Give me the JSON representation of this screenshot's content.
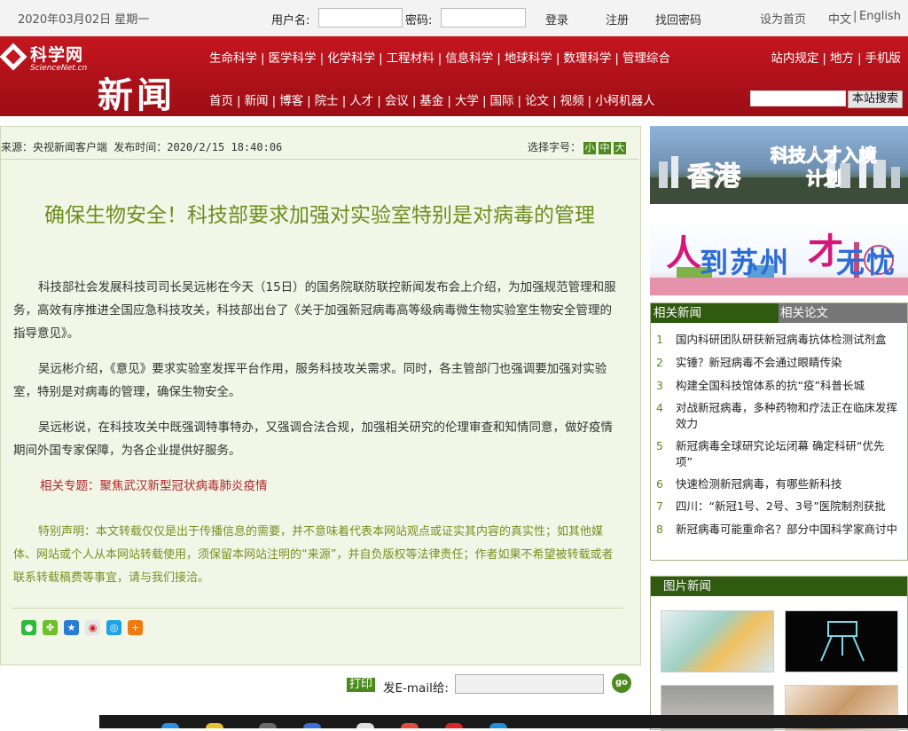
{
  "topbar": {
    "date": "2020年03月02日 星期一",
    "username_label": "用户名:",
    "password_label": "密码:",
    "login": "登录",
    "register": "注册",
    "recover_password": "找回密码",
    "set_homepage": "设为首页",
    "lang_cn": "中文",
    "lang_sep": "|",
    "lang_en": "English"
  },
  "header": {
    "logo_name": "科学网",
    "logo_en": "ScienceNet.cn",
    "section_title": "新闻",
    "nav_primary": [
      "生命科学",
      "医学科学",
      "化学科学",
      "工程材料",
      "信息科学",
      "地球科学",
      "数理科学",
      "管理综合"
    ],
    "nav_secondary": [
      "首页",
      "新闻",
      "博客",
      "院士",
      "人才",
      "会议",
      "基金",
      "大学",
      "国际",
      "论文",
      "视频",
      "小柯机器人"
    ],
    "nav_right": [
      "站内规定",
      "地方",
      "手机版"
    ],
    "search_button": "本站搜索",
    "separator": "|"
  },
  "article": {
    "meta": "来源：央视新闻客户端  发布时间：2020/2/15 18:40:06",
    "fontsize_label": "选择字号：",
    "fontsize_small": "小",
    "fontsize_medium": "中",
    "fontsize_large": "大",
    "title": "确保生物安全！科技部要求加强对实验室特别是对病毒的管理",
    "paragraphs": [
      "科技部社会发展科技司司长吴远彬在今天（15日）的国务院联防联控新闻发布会上介绍，为加强规范管理和服务，高效有序推进全国应急科技攻关，科技部出台了《关于加强新冠病毒高等级病毒微生物实验室生物安全管理的指导意见》。",
      "吴远彬介绍，《意见》要求实验室发挥平台作用，服务科技攻关需求。同时，各主管部门也强调要加强对实验室，特别是对病毒的管理，确保生物安全。",
      "吴远彬说，在科技攻关中既强调特事特办，又强调合法合规，加强相关研究的伦理审查和知情同意，做好疫情期间外国专家保障，为各企业提供好服务。"
    ],
    "topic": "相关专题：聚焦武汉新型冠状病毒肺炎疫情",
    "notice": "特别声明：本文转载仅仅是出于传播信息的需要，并不意味着代表本网站观点或证实其内容的真实性；如其他媒体、网站或个人从本网站转载使用，须保留本网站注明的“来源”，并自负版权等法律责任；作者如果不希望被转载或者联系转载稿费等事宜，请与我们接洽。",
    "print": "打印",
    "email_label": "发E-mail给:",
    "go": "go"
  },
  "sidebar": {
    "banner_hk_a": "香港",
    "banner_hk_b": "科技人才入境计划",
    "banner_sz_a": "人",
    "banner_sz_b": "到苏州",
    "banner_sz_c": "才",
    "banner_sz_d": "无忧",
    "tab_news": "相关新闻",
    "tab_papers": "相关论文",
    "related": [
      {
        "num": "1",
        "text": "国内科研团队研获新冠病毒抗体检测试剂盒"
      },
      {
        "num": "2",
        "text": "实锤？新冠病毒不会通过眼睛传染"
      },
      {
        "num": "3",
        "text": "构建全国科技馆体系的抗“疫”科普长城"
      },
      {
        "num": "4",
        "text": "对战新冠病毒，多种药物和疗法正在临床发挥效力"
      },
      {
        "num": "5",
        "text": "新冠病毒全球研究论坛闭幕 确定科研“优先项”"
      },
      {
        "num": "6",
        "text": "快速检测新冠病毒，有哪些新科技"
      },
      {
        "num": "7",
        "text": "四川：“新冠1号、2号、3号”医院制剂获批"
      },
      {
        "num": "8",
        "text": "新冠病毒可能重命名？部分中国科学家商讨中"
      }
    ],
    "photo_news": "图片新闻"
  },
  "colors": {
    "header_red": "#b8101a",
    "accent_green": "#4c8a1e",
    "title_green": "#6b8d1e",
    "topic_red": "#b0252a"
  }
}
